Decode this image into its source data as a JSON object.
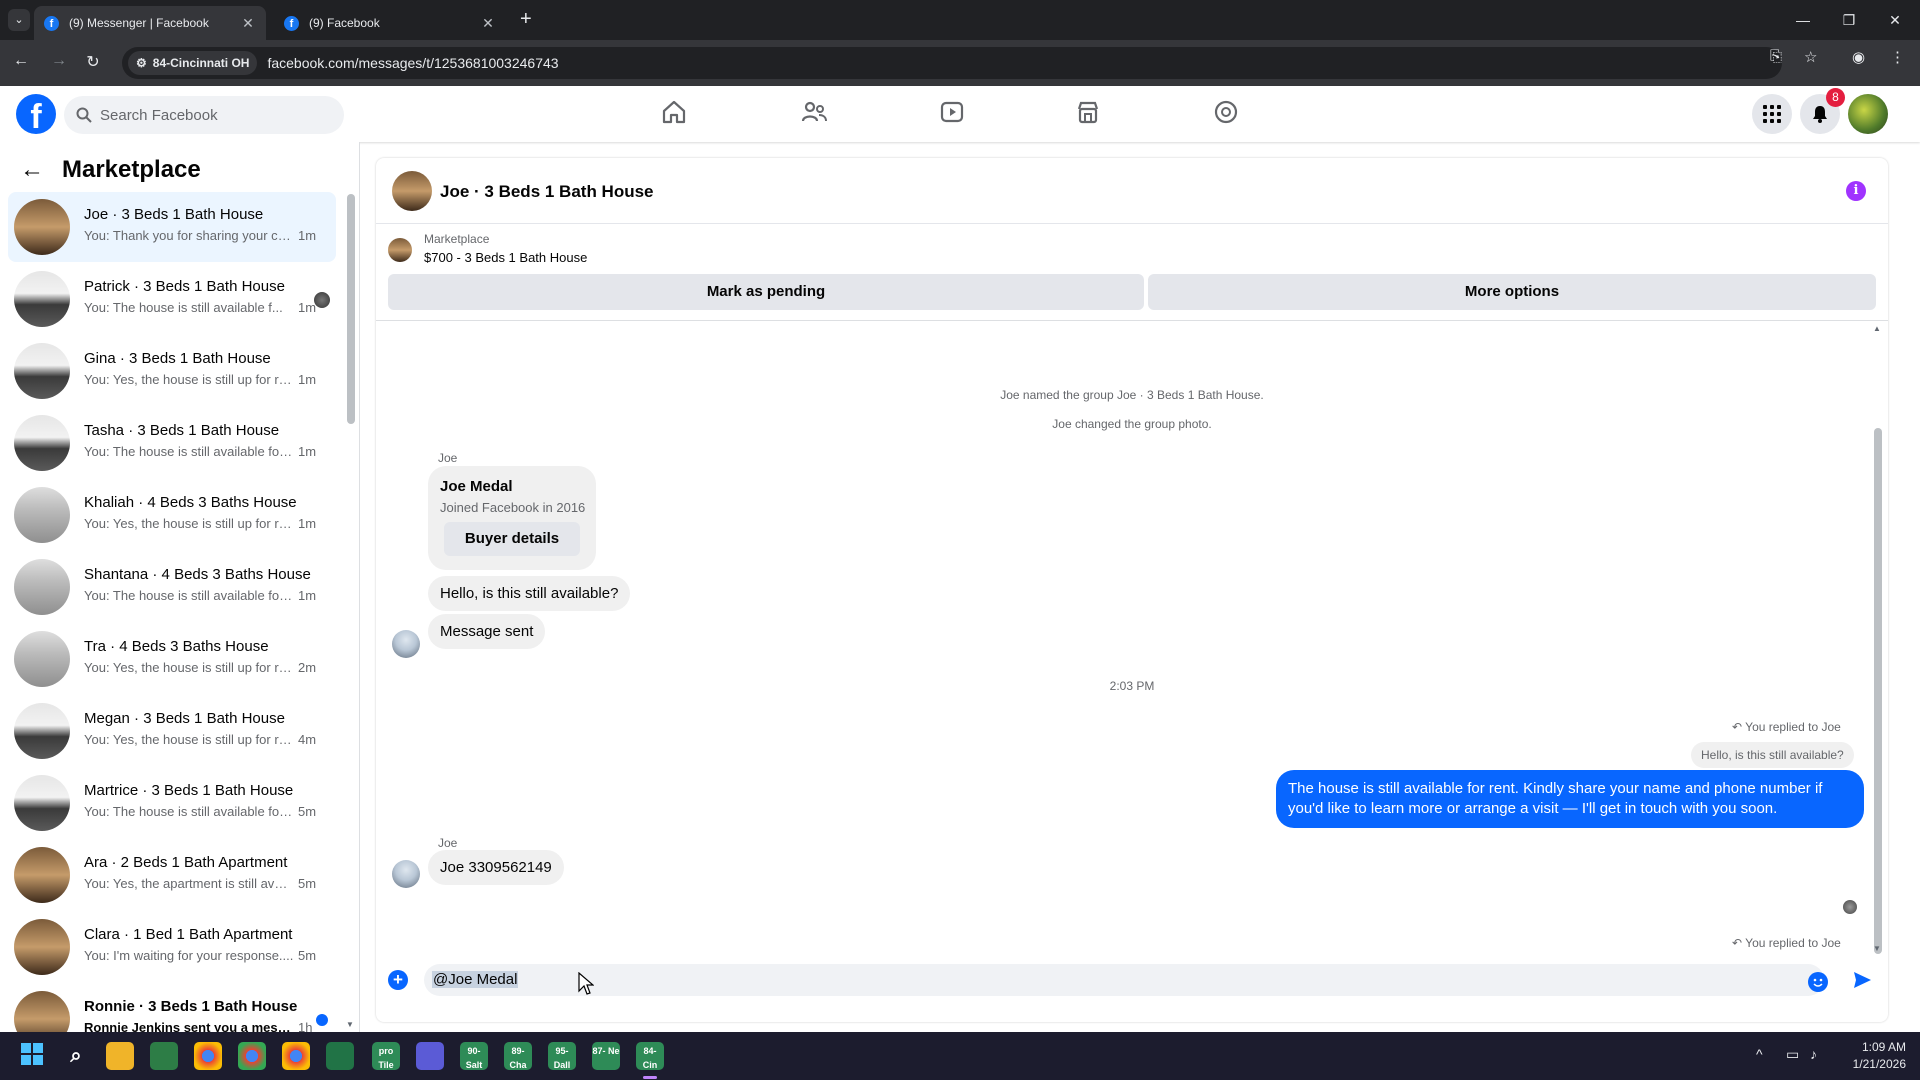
{
  "browser": {
    "tabs": [
      {
        "title": "(9) Messenger | Facebook",
        "active": true
      },
      {
        "title": "(9) Facebook",
        "active": false
      }
    ],
    "site_chip": "84-Cincinnati OH",
    "url": "facebook.com/messages/t/1253681003246743"
  },
  "fb": {
    "search_placeholder": "Search Facebook",
    "notification_count": "8"
  },
  "sidebar": {
    "title": "Marketplace",
    "conversations": [
      {
        "name": "Joe · 3 Beds 1 Bath House",
        "preview": "You: Thank you for sharing your co...",
        "time": "1m",
        "active": true
      },
      {
        "name": "Patrick · 3 Beds 1 Bath House",
        "preview": "You: The house is still available f...",
        "time": "1m"
      },
      {
        "name": "Gina · 3 Beds 1 Bath House",
        "preview": "You: Yes, the house is still up for re...",
        "time": "1m"
      },
      {
        "name": "Tasha · 3 Beds 1 Bath House",
        "preview": "You: The house is still available for ...",
        "time": "1m"
      },
      {
        "name": "Khaliah · 4 Beds 3 Baths House",
        "preview": "You: Yes, the house is still up for re...",
        "time": "1m"
      },
      {
        "name": "Shantana · 4 Beds 3 Baths House",
        "preview": "You: The house is still available for ...",
        "time": "1m"
      },
      {
        "name": "Tra · 4 Beds 3 Baths House",
        "preview": "You: Yes, the house is still up for re...",
        "time": "2m"
      },
      {
        "name": "Megan · 3 Beds 1 Bath House",
        "preview": "You: Yes, the house is still up for re...",
        "time": "4m"
      },
      {
        "name": "Martrice · 3 Beds 1 Bath House",
        "preview": "You: The house is still available for ...",
        "time": "5m"
      },
      {
        "name": "Ara · 2 Beds 1 Bath Apartment",
        "preview": "You: Yes, the apartment is still avail...",
        "time": "5m"
      },
      {
        "name": "Clara · 1 Bed 1 Bath Apartment",
        "preview": "You: I'm waiting for your response....",
        "time": "5m"
      },
      {
        "name": "Ronnie · 3 Beds 1 Bath House",
        "preview": "Ronnie Jenkins sent you a mess...",
        "time": "1h"
      }
    ]
  },
  "chat": {
    "title": "Joe · 3 Beds 1 Bath House",
    "marketplace_label": "Marketplace",
    "listing_price": "$700 - 3 Beds 1 Bath House",
    "mark_pending": "Mark as pending",
    "more_options": "More options",
    "system_1": "Joe named the group Joe · 3 Beds 1 Bath House.",
    "system_2": "Joe changed the group photo.",
    "sender": "Joe",
    "card_name": "Joe Medal",
    "card_sub": "Joined Facebook in 2016",
    "card_button": "Buyer details",
    "msg_1": "Hello, is this still available?",
    "msg_2": "Message sent",
    "timestamp": "2:03 PM",
    "replied_label": "You replied to Joe",
    "quoted": "Hello, is this still available?",
    "my_message": "The house is still available for rent. Kindly share your name and phone number if you'd like to learn more or arrange a visit — I'll get in touch with you soon.",
    "msg_3": "Joe 3309562149",
    "replied_label_2": "You replied to Joe",
    "composer_text": "@Joe Medal"
  },
  "taskbar": {
    "apps": [
      "pro Tile",
      "90- Salt",
      "89- Cha",
      "95- Dall",
      "87- Ne",
      "84- Cin"
    ],
    "time": "1:09 AM",
    "date": "1/21/2026"
  }
}
